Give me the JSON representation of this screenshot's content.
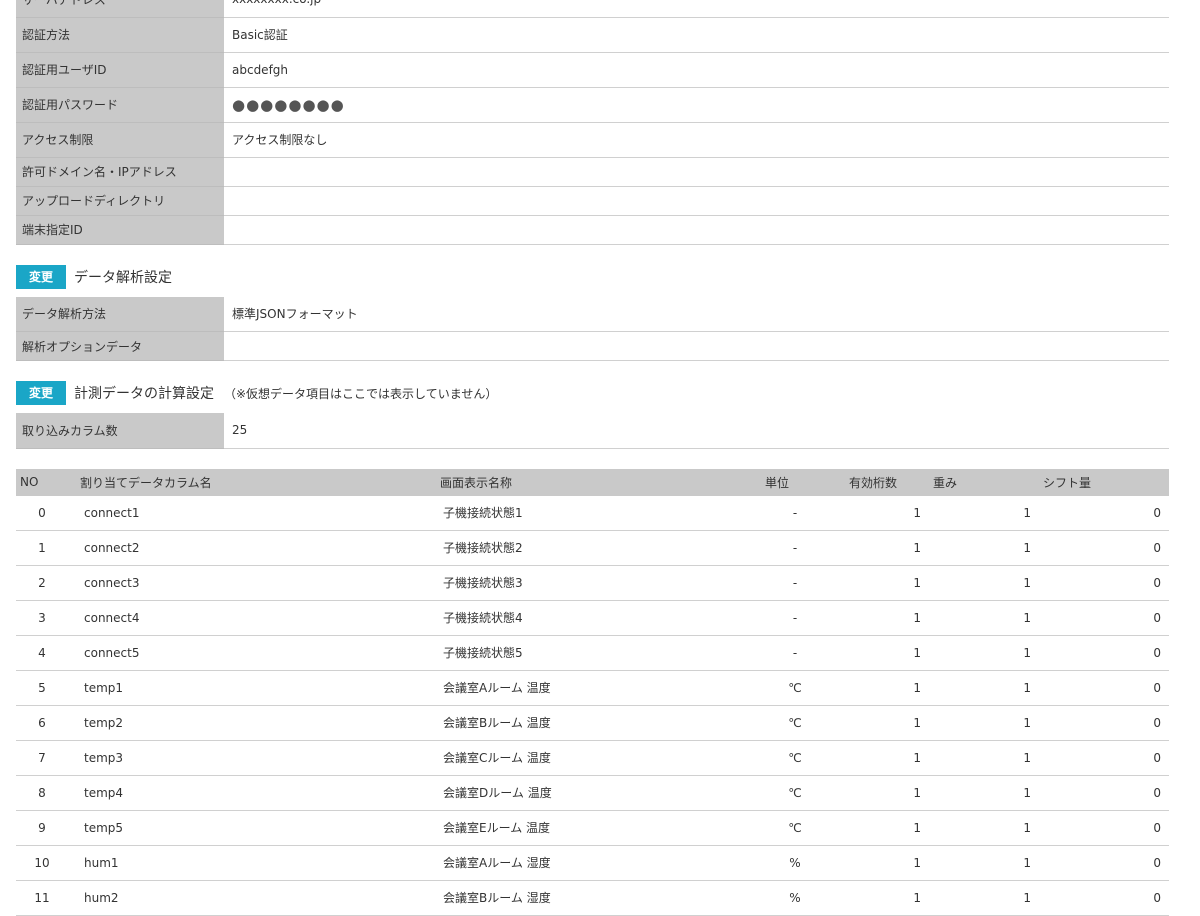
{
  "connection": {
    "rows": [
      {
        "label": "サーバアドレス",
        "value": "xxxxxxxx.co.jp"
      },
      {
        "label": "認証方法",
        "value": "Basic認証"
      },
      {
        "label": "認証用ユーザID",
        "value": "abcdefgh"
      },
      {
        "label": "認証用パスワード",
        "value": "●●●●●●●●"
      },
      {
        "label": "アクセス制限",
        "value": "アクセス制限なし"
      },
      {
        "label": "許可ドメイン名・IPアドレス",
        "value": ""
      },
      {
        "label": "アップロードディレクトリ",
        "value": ""
      },
      {
        "label": "端末指定ID",
        "value": ""
      }
    ]
  },
  "analysis": {
    "change_label": "変更",
    "title": "データ解析設定",
    "rows": [
      {
        "label": "データ解析方法",
        "value": "標準JSONフォーマット"
      },
      {
        "label": "解析オプションデータ",
        "value": ""
      }
    ]
  },
  "calc": {
    "change_label": "変更",
    "title": "計測データの計算設定",
    "note": "（※仮想データ項目はここでは表示していません）",
    "rows": [
      {
        "label": "取り込みカラム数",
        "value": "25"
      }
    ]
  },
  "columns_table": {
    "headers": [
      "NO",
      "割り当てデータカラム名",
      "画面表示名称",
      "単位",
      "有効桁数",
      "重み",
      "シフト量"
    ],
    "rows": [
      [
        "0",
        "connect1",
        "子機接続状態1",
        "-",
        "1",
        "1",
        "0"
      ],
      [
        "1",
        "connect2",
        "子機接続状態2",
        "-",
        "1",
        "1",
        "0"
      ],
      [
        "2",
        "connect3",
        "子機接続状態3",
        "-",
        "1",
        "1",
        "0"
      ],
      [
        "3",
        "connect4",
        "子機接続状態4",
        "-",
        "1",
        "1",
        "0"
      ],
      [
        "4",
        "connect5",
        "子機接続状態5",
        "-",
        "1",
        "1",
        "0"
      ],
      [
        "5",
        "temp1",
        "会議室Aルーム 温度",
        "℃",
        "1",
        "1",
        "0"
      ],
      [
        "6",
        "temp2",
        "会議室Bルーム 温度",
        "℃",
        "1",
        "1",
        "0"
      ],
      [
        "7",
        "temp3",
        "会議室Cルーム 温度",
        "℃",
        "1",
        "1",
        "0"
      ],
      [
        "8",
        "temp4",
        "会議室Dルーム 温度",
        "℃",
        "1",
        "1",
        "0"
      ],
      [
        "9",
        "temp5",
        "会議室Eルーム 温度",
        "℃",
        "1",
        "1",
        "0"
      ],
      [
        "10",
        "hum1",
        "会議室Aルーム 湿度",
        "%",
        "1",
        "1",
        "0"
      ],
      [
        "11",
        "hum2",
        "会議室Bルーム 湿度",
        "%",
        "1",
        "1",
        "0"
      ]
    ]
  }
}
